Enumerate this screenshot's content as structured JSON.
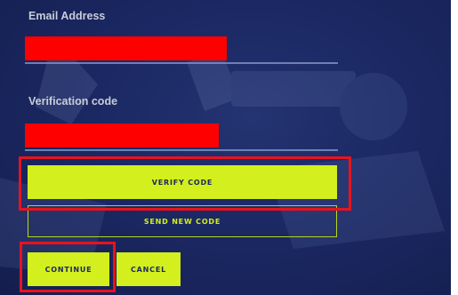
{
  "form": {
    "email_label": "Email Address",
    "code_label": "Verification code"
  },
  "buttons": {
    "verify": "VERIFY CODE",
    "send_new": "SEND NEW CODE",
    "continue": "CONTINUE",
    "cancel": "CANCEL"
  },
  "colors": {
    "background": "#1c2a66",
    "accent": "#d3ef1d",
    "highlight": "#e8131d",
    "redaction": "#ff0000"
  }
}
